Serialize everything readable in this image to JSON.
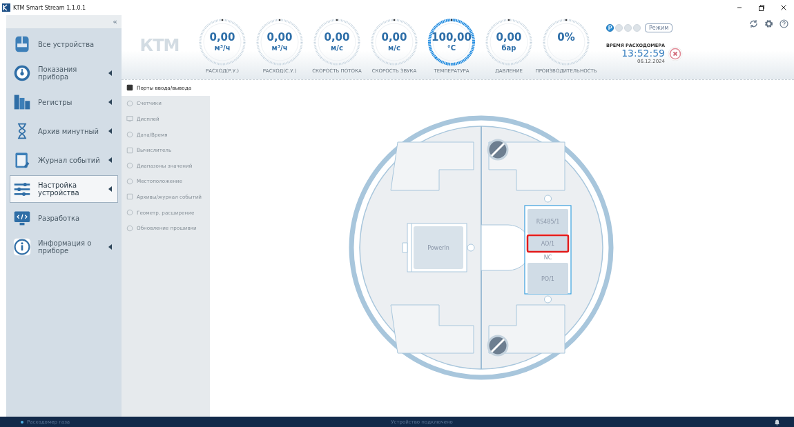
{
  "window": {
    "title": "KTM Smart Stream 1.1.0.1"
  },
  "sidebar": {
    "collapse": "«",
    "items": [
      {
        "label": "Все устройства",
        "selected": false,
        "expandable": false
      },
      {
        "label": "Показания прибора",
        "selected": false,
        "expandable": true
      },
      {
        "label": "Регистры",
        "selected": false,
        "expandable": true
      },
      {
        "label": "Архив минутный",
        "selected": false,
        "expandable": true
      },
      {
        "label": "Журнал событий",
        "selected": false,
        "expandable": true
      },
      {
        "label": "Настройка устройства",
        "selected": true,
        "expandable": true
      },
      {
        "label": "Разработка",
        "selected": false,
        "expandable": false
      },
      {
        "label": "Информация о приборе",
        "selected": false,
        "expandable": true
      }
    ]
  },
  "header": {
    "logo": "КТМ",
    "gauges": [
      {
        "value": "0,00",
        "unit": "м³/ч",
        "label": "РАСХОД(Р.У.)",
        "highlighted": false
      },
      {
        "value": "0,00",
        "unit": "м³/ч",
        "label": "РАСХОД(С.У.)",
        "highlighted": false
      },
      {
        "value": "0,00",
        "unit": "м/с",
        "label": "СКОРОСТЬ ПОТОКА",
        "highlighted": false
      },
      {
        "value": "0,00",
        "unit": "м/с",
        "label": "СКОРОСТЬ ЗВУКА",
        "highlighted": false
      },
      {
        "value": "100,00",
        "unit": "°C",
        "label": "ТЕМПЕРАТУРА",
        "highlighted": true
      },
      {
        "value": "0,00",
        "unit": "бар",
        "label": "ДАВЛЕНИЕ",
        "highlighted": false
      },
      {
        "value": "0%",
        "label": "ПРОИЗВОДИТЕЛЬНОСТЬ",
        "highlighted": false
      }
    ],
    "modes": [
      {
        "active": true
      },
      {
        "active": false
      },
      {
        "active": false
      },
      {
        "active": false
      }
    ],
    "mode_button": "Режим",
    "time_label": "ВРЕМЯ РАСХОДОМЕРА",
    "time": "13:52:59",
    "date": "06.12.2024"
  },
  "submenu": [
    {
      "label": "Порты ввода/вывода",
      "selected": true,
      "disabled": false
    },
    {
      "label": "Счетчики",
      "selected": false,
      "disabled": true
    },
    {
      "label": "Дисплей",
      "selected": false,
      "disabled": true
    },
    {
      "label": "Дата/Время",
      "selected": false,
      "disabled": true
    },
    {
      "label": "Вычислитель",
      "selected": false,
      "disabled": true
    },
    {
      "label": "Диапазоны значений",
      "selected": false,
      "disabled": true
    },
    {
      "label": "Местоположение",
      "selected": false,
      "disabled": true
    },
    {
      "label": "Архивы/журнал событий",
      "selected": false,
      "disabled": true
    },
    {
      "label": "Геометр. расширение",
      "selected": false,
      "disabled": true
    },
    {
      "label": "Обновление прошивки",
      "selected": false,
      "disabled": true
    }
  ],
  "diagram": {
    "power_module": "PowerIn",
    "ports": [
      {
        "label": "RS485/1",
        "kind": "slot",
        "selected": false
      },
      {
        "label": "AO/1",
        "kind": "slot",
        "selected": true
      },
      {
        "label": "NC",
        "kind": "gap",
        "selected": false
      },
      {
        "label": "PO/1",
        "kind": "slot",
        "selected": false
      }
    ]
  },
  "status_bar": {
    "device_type": "Расходомер газа",
    "connection": "Устройство подключено"
  }
}
